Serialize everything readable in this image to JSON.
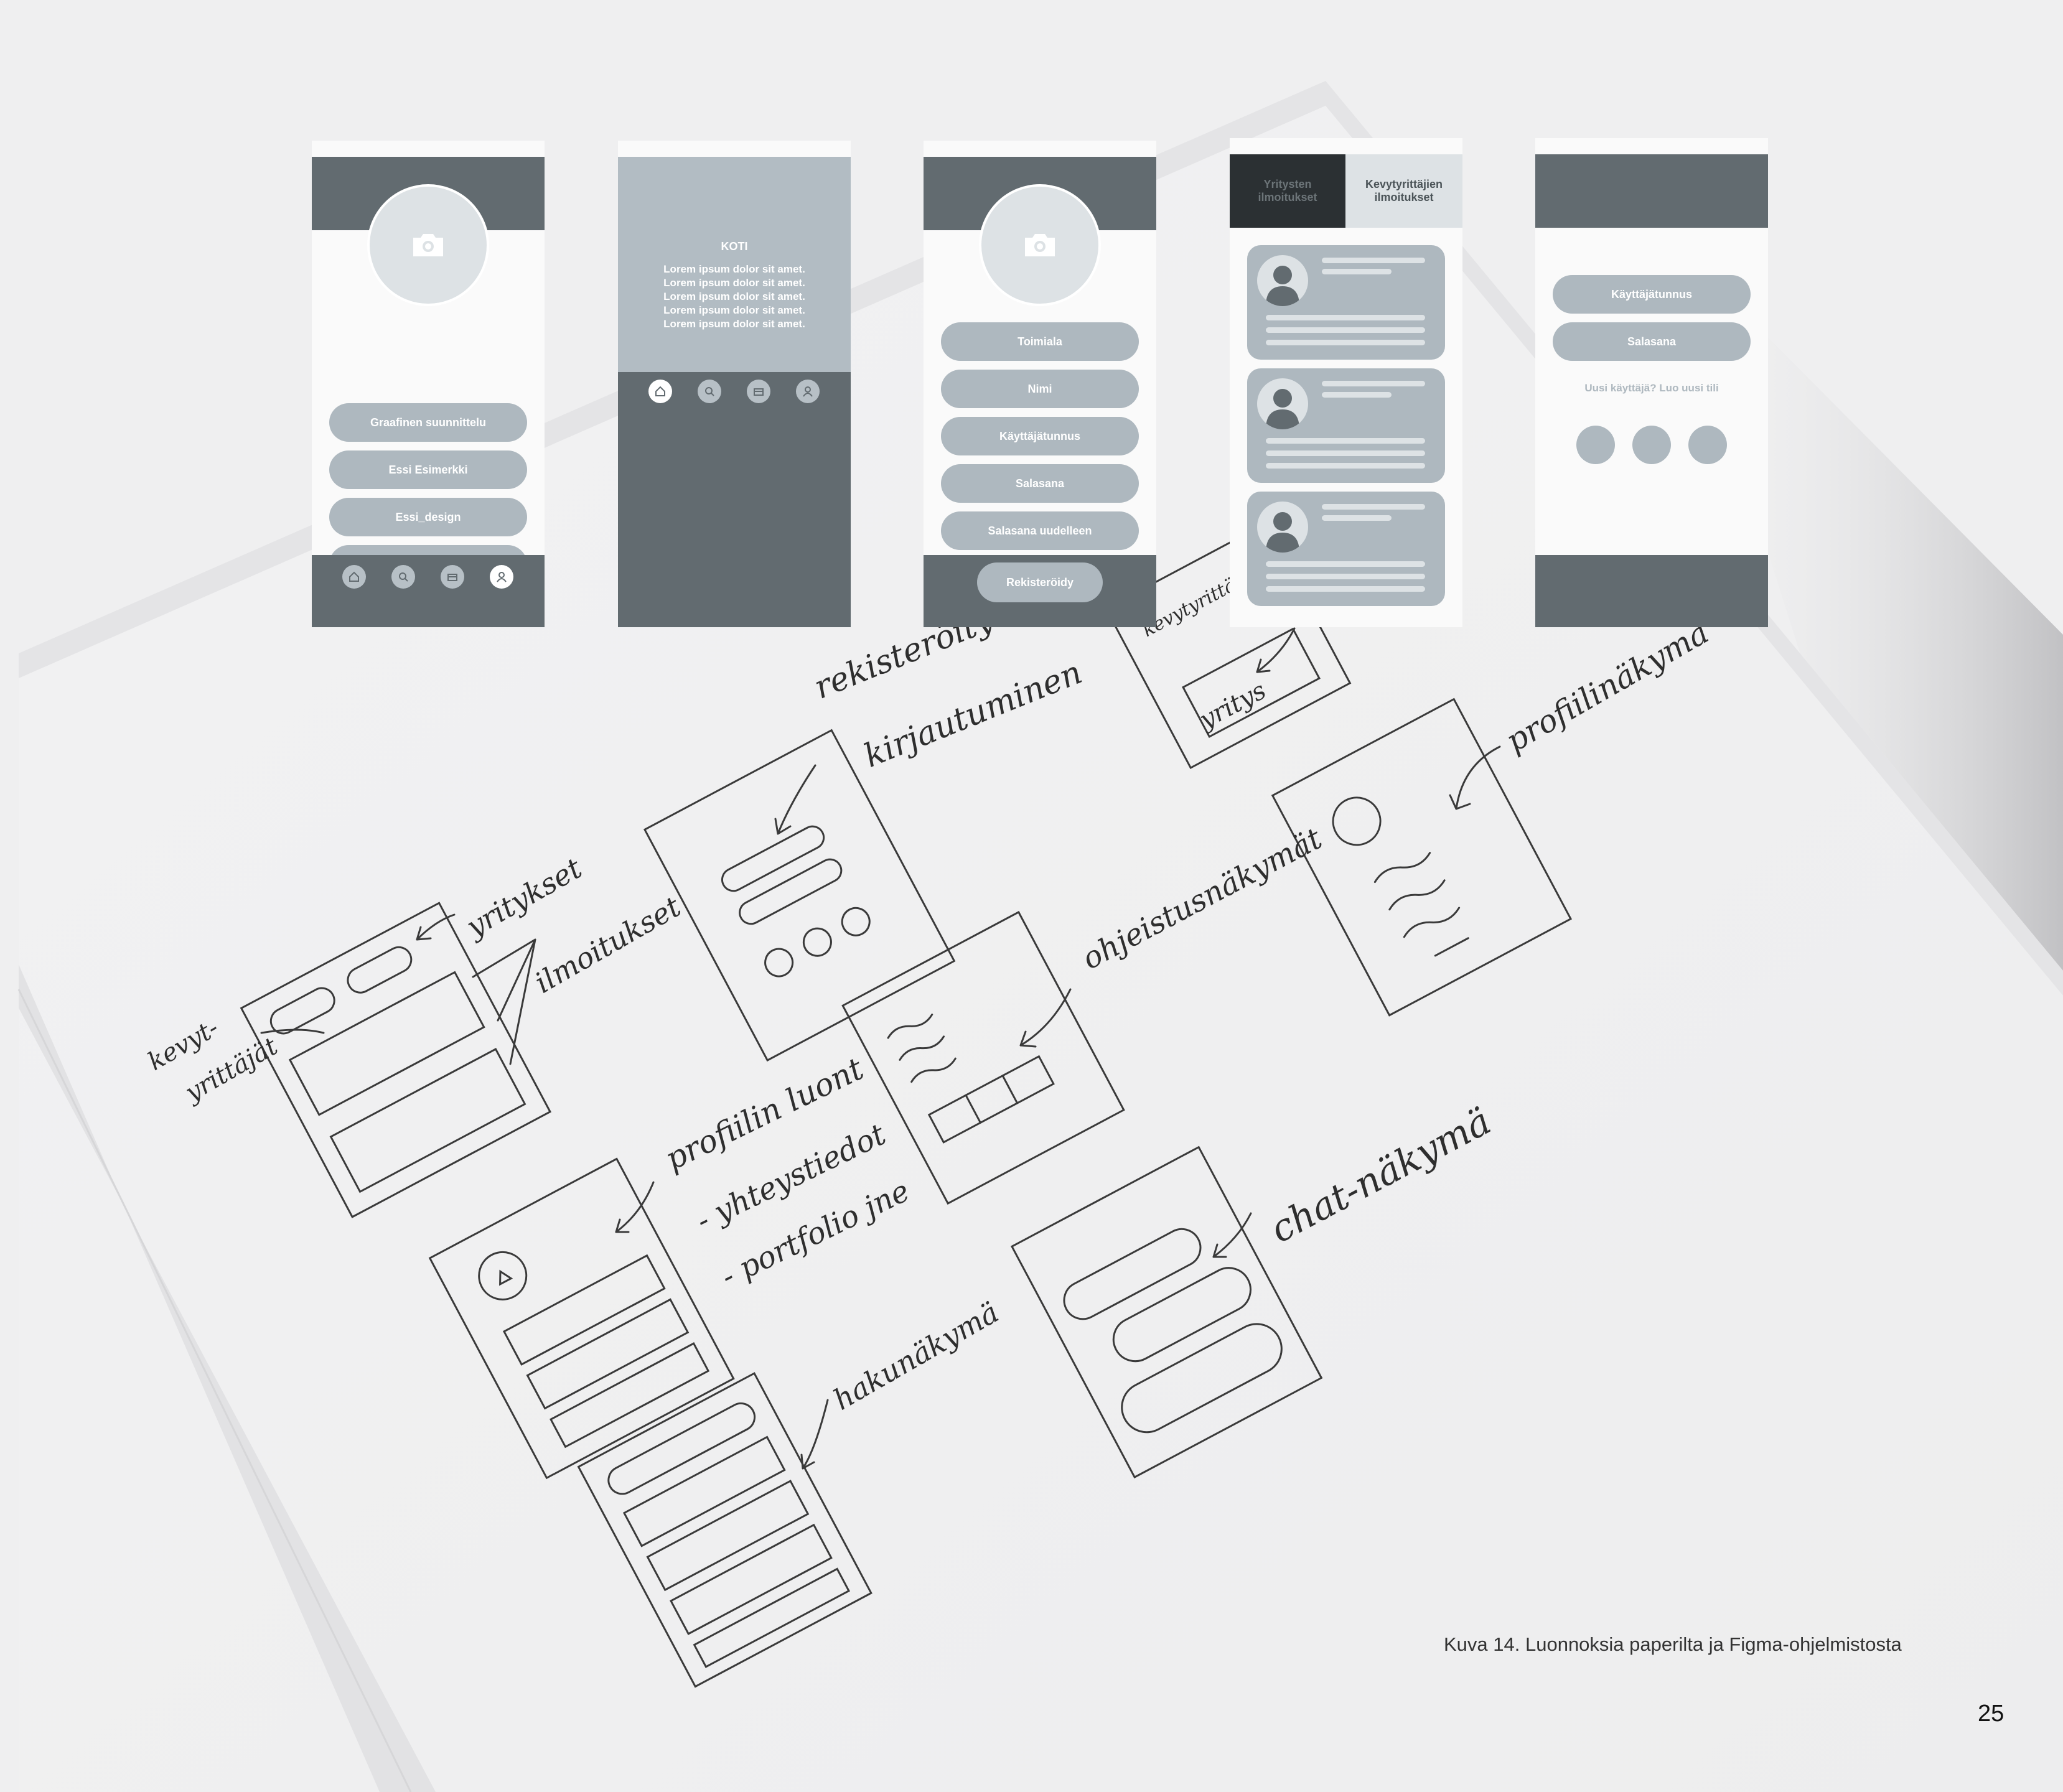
{
  "phone1": {
    "buttons": [
      "Graafinen suunnittelu",
      "Essi Esimerkki",
      "Essi_design"
    ]
  },
  "phone2": {
    "title": "KOTI",
    "lorem_lines": [
      "Lorem ipsum dolor sit amet.",
      "Lorem ipsum dolor sit amet.",
      "Lorem ipsum dolor sit amet.",
      "Lorem ipsum dolor sit amet.",
      "Lorem ipsum dolor sit amet."
    ]
  },
  "phone3": {
    "fields": [
      "Toimiala",
      "Nimi",
      "Käyttäjätunnus",
      "Salasana",
      "Salasana uudelleen"
    ],
    "register_label": "Rekisteröidy"
  },
  "phone4": {
    "tab_companies": [
      "Yritysten",
      "ilmoitukset"
    ],
    "tab_freelancers": [
      "Kevytyrittäjien",
      "ilmoitukset"
    ]
  },
  "phone5": {
    "username": "Käyttäjätunnus",
    "password": "Salasana",
    "new_user": "Uusi käyttäjä? Luo uusi tili"
  },
  "sketch_labels": {
    "registration": "rekisteröityminen/",
    "login": "kirjautuminen",
    "companies": "yritykset",
    "listings": "ilmoitukset",
    "freelancers_1": "kevyt-",
    "freelancers_2": "yrittäjät",
    "profile_view": "profiilinäkymä",
    "instructions": "ohjeistusnäkymät",
    "company": "yritys",
    "freelancer_top": "kevytyrittäjä",
    "profile_create": "profiilin luont",
    "contacts": "- yhteystiedot",
    "portfolio": "- portfolio jne",
    "search_view": "hakunäkymä",
    "chat_view": "chat-näkymä"
  },
  "caption": "Kuva 14. Luonnoksia paperilta ja Figma-ohjelmistosta",
  "page_number": "25",
  "colors": {
    "dark": "#626b70",
    "mid": "#aeb8bf",
    "light": "#dde2e5",
    "black_tab": "#2b3033"
  }
}
